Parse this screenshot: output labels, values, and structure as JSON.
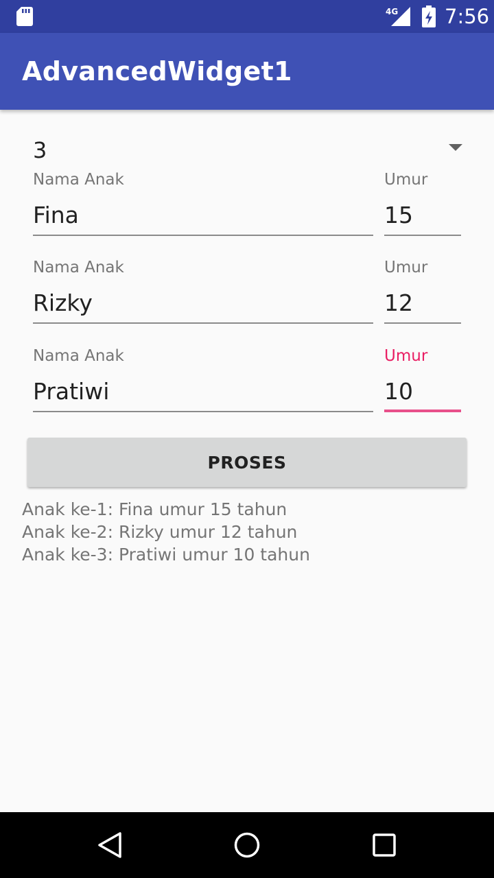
{
  "status_bar": {
    "time": "7:56",
    "network_label": "4G",
    "icons": [
      "sd-card-icon",
      "signal-4g-icon",
      "battery-charging-icon"
    ]
  },
  "app_bar": {
    "title": "AdvancedWidget1"
  },
  "spinner": {
    "selected_value": "3"
  },
  "rows": [
    {
      "name_label": "Nama Anak",
      "name_value": "Fina",
      "age_label": "Umur",
      "age_value": "15"
    },
    {
      "name_label": "Nama Anak",
      "name_value": "Rizky",
      "age_label": "Umur",
      "age_value": "12"
    },
    {
      "name_label": "Nama Anak",
      "name_value": "Pratiwi",
      "age_label": "Umur",
      "age_value": "10"
    }
  ],
  "button": {
    "label": "PROSES"
  },
  "result_lines": [
    "Anak ke-1: Fina umur 15 tahun",
    "Anak ke-2: Rizky umur 12 tahun",
    "Anak ke-3: Pratiwi umur 10 tahun"
  ],
  "nav_bar": {
    "icons": [
      "back-icon",
      "home-icon",
      "recents-icon"
    ]
  },
  "colors": {
    "primary": "#3f51b5",
    "primary_dark": "#303f9f",
    "accent": "#e91e63",
    "button_bg": "#d6d7d7",
    "background": "#fafafa"
  }
}
